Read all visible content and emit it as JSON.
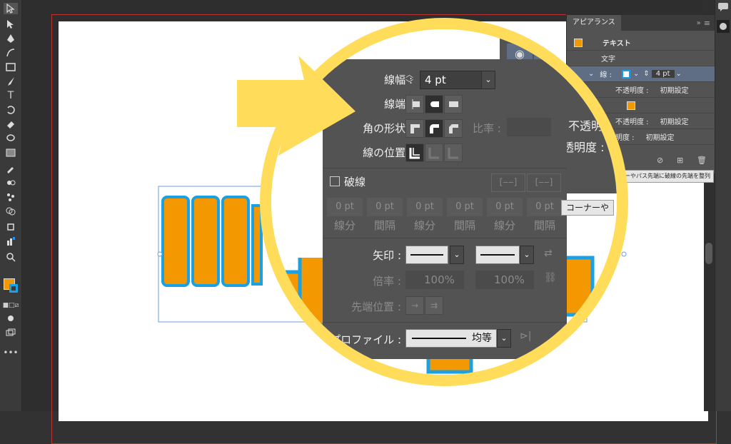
{
  "colors": {
    "accent_orange": "#f39800",
    "outline_blue": "#1ba1e2",
    "highlight_yellow": "#ffdc5a",
    "panel_gray": "#535353",
    "artboard_border": "#bb3333"
  },
  "toolbar": {
    "icons": [
      "selection-icon",
      "direct-selection-icon",
      "pen-icon",
      "curvature-icon",
      "rectangle-icon",
      "paintbrush-icon",
      "type-icon",
      "rotate-icon",
      "eraser-icon",
      "lasso-icon",
      "gradient-icon",
      "eyedropper-icon",
      "blend-icon",
      "symbol-sprayer-icon",
      "shape-builder-icon",
      "artboard-icon",
      "graph-icon",
      "zoom-icon",
      "fill-stroke-icon",
      "draw-mode-icon",
      "screen-mode-icon",
      "more-tools-icon"
    ]
  },
  "appearance": {
    "tab_label": "アピアランス",
    "row_text": "テキスト",
    "row_characters": "文字",
    "row_stroke_label": "線 :",
    "row_stroke_value": "4 pt",
    "row_opacity_label": "不透明度 :",
    "row_opacity_value": "初期設定",
    "row_opacity2_label": "不透明度 :",
    "row_opacity2_value": "初期設定",
    "row_opacity3_label": "明度 :",
    "row_opacity3_value": "初期設定"
  },
  "tooltip_small": "ーやパス先端に破線の先端を整列",
  "tooltip_large": "コーナーや",
  "stroke_panel": {
    "weight_label": "線幅 :",
    "weight_value": "4 pt",
    "cap_label": "線端 :",
    "corner_label": "角の形状 :",
    "limit_label": "比率 :",
    "align_label": "線の位置 :",
    "dashed_label": "破線",
    "dash_values": [
      "0 pt",
      "0 pt",
      "0 pt",
      "0 pt",
      "0 pt",
      "0 pt"
    ],
    "dash_labels": [
      "線分",
      "間隔",
      "線分",
      "間隔",
      "線分",
      "間隔"
    ],
    "arrow_label": "矢印 :",
    "scale_label": "倍率 :",
    "scale_start": "100%",
    "scale_end": "100%",
    "align_tip_label": "先端位置 :",
    "profile_label": "プロファイル :",
    "profile_value": "均等"
  },
  "magnified_appearance": {
    "opacity_label": "不透明",
    "brightness_label": "透明度 :",
    "colon": ":"
  }
}
